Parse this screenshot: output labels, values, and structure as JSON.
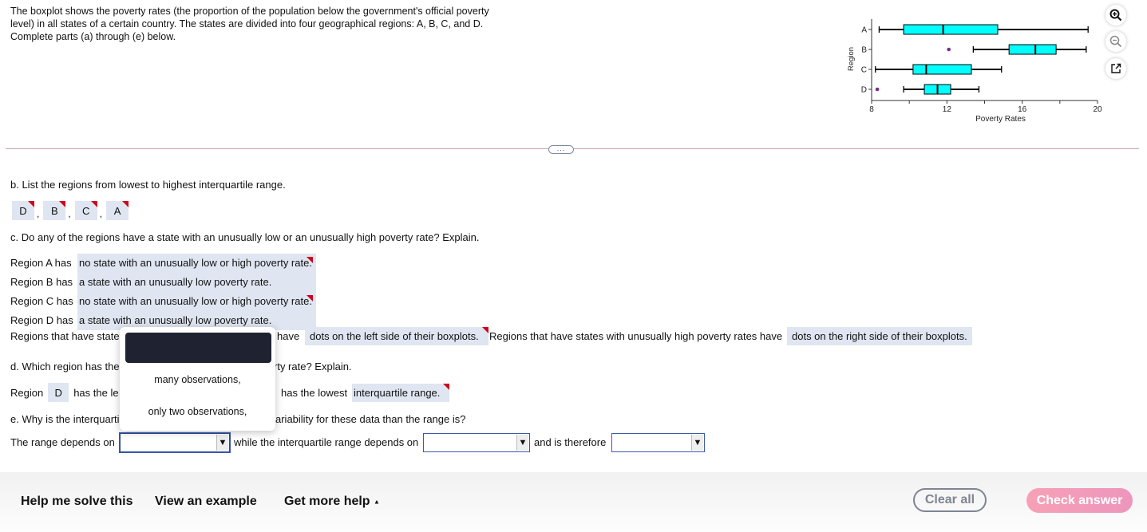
{
  "intro": "The boxplot shows the poverty rates (the proportion of the population below the government's official poverty level) in all states of a certain country. The states are divided into four geographical regions: A, B, C, and D. Complete parts (a) through (e) below.",
  "tools": {
    "zoom_in": "zoom-in-icon",
    "zoom_out": "zoom-out-icon",
    "popout": "popout-icon"
  },
  "more_label": "...",
  "chart_data": {
    "type": "boxplot",
    "orientation": "horizontal",
    "title": "",
    "xlabel": "Poverty Rates",
    "ylabel": "Region",
    "xlim": [
      8,
      20
    ],
    "xticks": [
      "8",
      "12",
      "16",
      "20"
    ],
    "categories": [
      "A",
      "B",
      "C",
      "D"
    ],
    "series": [
      {
        "name": "A",
        "min": 8.4,
        "q1": 9.7,
        "median": 11.8,
        "q3": 14.7,
        "max": 19.5,
        "outliers": []
      },
      {
        "name": "B",
        "min": 13.4,
        "q1": 15.3,
        "median": 16.7,
        "q3": 17.8,
        "max": 19.4,
        "outliers": [
          12.1
        ]
      },
      {
        "name": "C",
        "min": 8.2,
        "q1": 10.2,
        "median": 10.9,
        "q3": 13.3,
        "max": 14.9,
        "outliers": []
      },
      {
        "name": "D",
        "min": 9.7,
        "q1": 10.8,
        "median": 11.5,
        "q3": 12.2,
        "max": 13.7,
        "outliers": [
          8.3
        ]
      }
    ],
    "box_color": "#00ffff",
    "outlier_color": "#7b2c8f"
  },
  "part_b": {
    "question": "b. List the regions from lowest to highest interquartile range.",
    "answers": [
      "D",
      "B",
      "C",
      "A"
    ],
    "separator": ","
  },
  "part_c": {
    "question": "c. Do any of the regions have a state with an unusually low or an unusually high poverty rate? Explain.",
    "rows": [
      {
        "label": "Region A has",
        "answer": "no state with an unusually low or high poverty rate.",
        "flag": true
      },
      {
        "label": "Region B has",
        "answer": "a state with an unusually low poverty rate.",
        "flag": false
      },
      {
        "label": "Region C has",
        "answer": "no state with an unusually low or high poverty rate.",
        "flag": true
      },
      {
        "label": "Region D has",
        "answer": "a state with an unusually low poverty rate.",
        "flag": false
      }
    ],
    "summary_prefix": "Regions that have state",
    "summary_have": "have",
    "low_answer": "dots on the left side of their boxplots.",
    "high_text": "Regions that have states with unusually high poverty rates have",
    "high_answer": "dots on the right side of their boxplots."
  },
  "part_d": {
    "question_prefix": "d. Which region has the",
    "question_suffix": "rty rate? Explain.",
    "region_label": "Region",
    "region_answer": "D",
    "middle_prefix": "has the le",
    "middle_suffix": "has the lowest",
    "reason_answer": "interquartile range."
  },
  "part_e": {
    "question_prefix": "e. Why is the interquarti",
    "question_suffix": "ariability for these data than the range is?",
    "text1": "The range depends on",
    "text2": "while the interquartile range depends on",
    "text3": "and is therefore",
    "select1_value": "",
    "select2_value": "",
    "select3_value": ""
  },
  "dropdown": {
    "options": [
      "",
      "many observations,",
      "only two observations,"
    ],
    "highlighted_index": 0
  },
  "footer": {
    "help_solve": "Help me solve this",
    "view_example": "View an example",
    "more_help": "Get more help",
    "more_help_caret": "▲",
    "clear_all": "Clear all",
    "check_answer": "Check answer"
  }
}
